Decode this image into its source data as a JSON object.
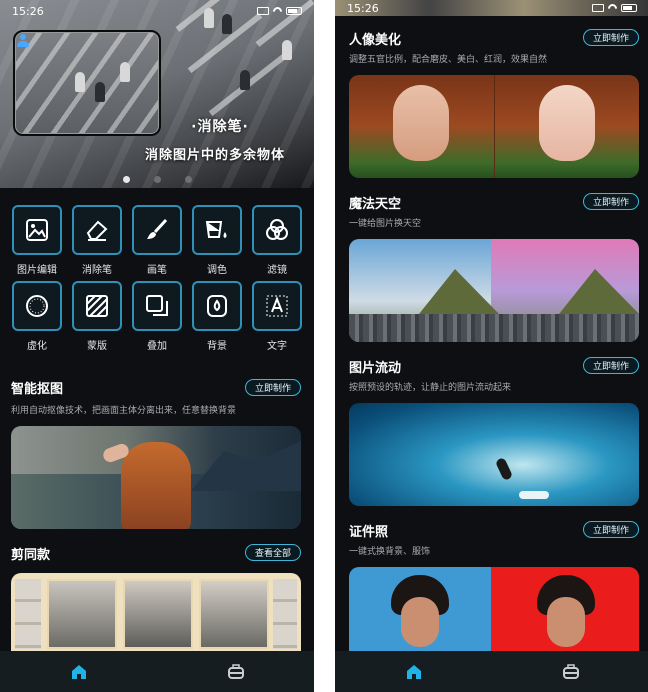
{
  "status_bar": {
    "time": "15:26"
  },
  "left": {
    "banner": {
      "title": "·消除笔·",
      "subtitle": "消除图片中的多余物体"
    },
    "tools": [
      {
        "label": "图片编辑",
        "icon": "image-edit-icon"
      },
      {
        "label": "消除笔",
        "icon": "eraser-icon"
      },
      {
        "label": "画笔",
        "icon": "brush-icon"
      },
      {
        "label": "调色",
        "icon": "paint-bucket-icon"
      },
      {
        "label": "滤镜",
        "icon": "filter-icon"
      },
      {
        "label": "虚化",
        "icon": "blur-icon"
      },
      {
        "label": "蒙版",
        "icon": "mask-icon"
      },
      {
        "label": "叠加",
        "icon": "overlay-icon"
      },
      {
        "label": "背景",
        "icon": "background-icon"
      },
      {
        "label": "文字",
        "icon": "text-icon"
      }
    ],
    "smart_cutout": {
      "title": "智能抠图",
      "button": "立即制作",
      "desc": "利用自动抠像技术，把画面主体分离出来，任意替换背景"
    },
    "jiantong": {
      "title": "剪同款",
      "button": "查看全部"
    }
  },
  "right": {
    "sections": [
      {
        "title": "人像美化",
        "button": "立即制作",
        "desc": "调整五官比例，配合磨皮、美白、红润，效果自然"
      },
      {
        "title": "魔法天空",
        "button": "立即制作",
        "desc": "一键给图片换天空"
      },
      {
        "title": "图片流动",
        "button": "立即制作",
        "desc": "按照预设的轨迹，让静止的图片流动起来"
      },
      {
        "title": "证件照",
        "button": "立即制作",
        "desc": "一键式换背景、服饰"
      }
    ]
  },
  "tabbar": {
    "home_icon": "home-icon",
    "toolbox_icon": "toolbox-icon",
    "accent": "#1fb3e6"
  }
}
